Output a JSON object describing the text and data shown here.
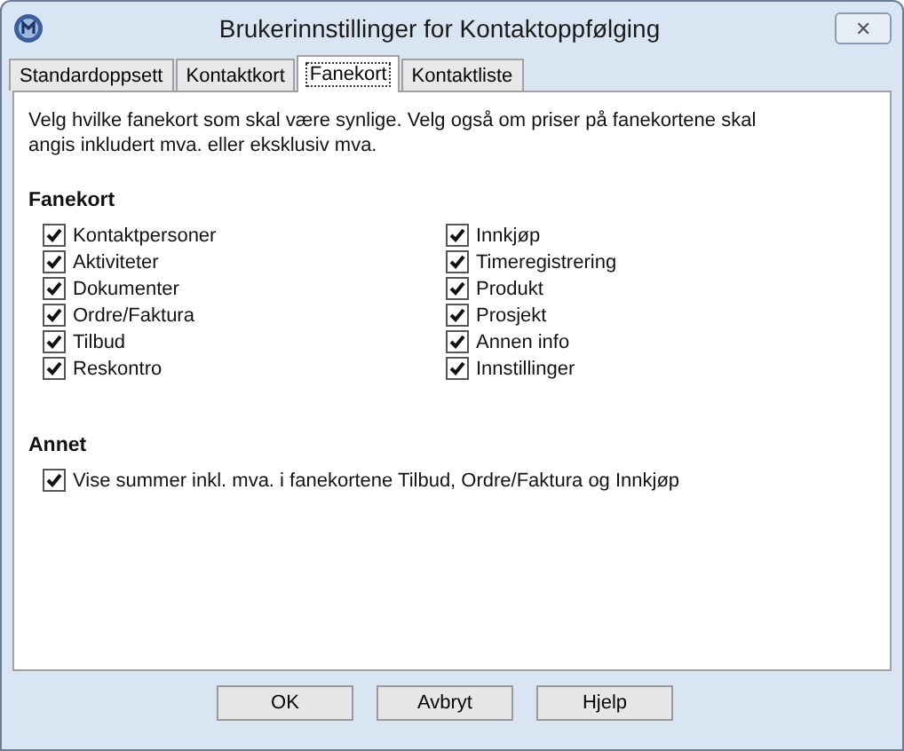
{
  "window": {
    "title": "Brukerinnstillinger for Kontaktoppfølging",
    "close": "✕"
  },
  "tabs": [
    {
      "label": "Standardoppsett",
      "selected": false
    },
    {
      "label": "Kontaktkort",
      "selected": false
    },
    {
      "label": "Fanekort",
      "selected": true
    },
    {
      "label": "Kontaktliste",
      "selected": false
    }
  ],
  "intro": "Velg hvilke fanekort som skal være synlige. Velg også om priser på fanekortene skal angis inkludert mva. eller eksklusiv mva.",
  "fanekort": {
    "heading": "Fanekort",
    "columns": [
      [
        {
          "label": "Kontaktpersoner",
          "checked": true
        },
        {
          "label": "Aktiviteter",
          "checked": true
        },
        {
          "label": "Dokumenter",
          "checked": true
        },
        {
          "label": "Ordre/Faktura",
          "checked": true
        },
        {
          "label": "Tilbud",
          "checked": true
        },
        {
          "label": "Reskontro",
          "checked": true
        }
      ],
      [
        {
          "label": "Innkjøp",
          "checked": true
        },
        {
          "label": "Timeregistrering",
          "checked": true
        },
        {
          "label": "Produkt",
          "checked": true
        },
        {
          "label": "Prosjekt",
          "checked": true
        },
        {
          "label": "Annen info",
          "checked": true
        },
        {
          "label": "Innstillinger",
          "checked": true
        }
      ]
    ]
  },
  "annet": {
    "heading": "Annet",
    "items": [
      {
        "label": "Vise summer inkl. mva. i fanekortene Tilbud, Ordre/Faktura og Innkjøp",
        "checked": true
      }
    ]
  },
  "buttons": [
    "OK",
    "Avbryt",
    "Hjelp"
  ]
}
